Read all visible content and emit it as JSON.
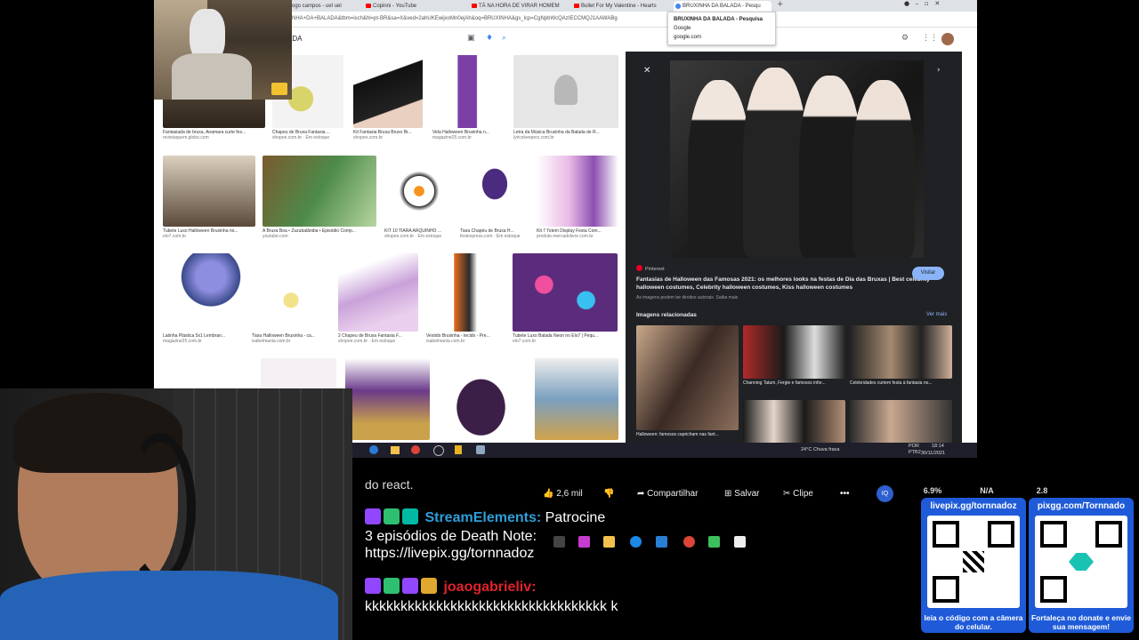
{
  "browser": {
    "tabs": [
      {
        "label": "ogo campos - uel uel"
      },
      {
        "label": "Copinni - YouTube"
      },
      {
        "label": "TÁ NA HORA DE VIRAR HOMEM"
      },
      {
        "label": "Bullet For My Valentine - Hearts"
      },
      {
        "label": "BRUXINHA DA BALADA - Pesqu"
      }
    ],
    "address": "NHA+DA+BALADA&tbm=isch&hl=pt-BR&sa=X&ved=2ahUKEwijxoMn0ejAh&oq=BRUXINHA&gs_lcp=CgNpbWcQAzIECCMQJ1AAWABg",
    "search_query": "ADA",
    "tooltip": {
      "title": "BRUXINHA DA BALADA - Pesquisa",
      "line2": "Google",
      "line3": "google.com"
    }
  },
  "results": [
    {
      "caption": "Fantasiada de bruxa, Anamara curte fes...",
      "source": "revistaquem.globo.com"
    },
    {
      "caption": "Chapeu de Bruxa Fantasia ...",
      "source": "shopee.com.br · Em estoque"
    },
    {
      "caption": "Kit Fantasia Bruxa Bruxo Br...",
      "source": "shopee.com.br"
    },
    {
      "caption": "Vela Halloween Bruxinha n...",
      "source": "magazine25.com.br"
    },
    {
      "caption": "Letra da Música Bruxinha da Balada de R...",
      "source": "lyricskeepers.com.br"
    },
    {
      "caption": "Tubete Luxo Halloween Bruxinha no...",
      "source": "elo7.com.br"
    },
    {
      "caption": "A Bruxa Boa • Zuzubalândia • Episódio Comp...",
      "source": "youtube.com"
    },
    {
      "caption": "KIT 10 TIARA ARQUINHO ...",
      "source": "shopee.com.br · Em estoque"
    },
    {
      "caption": "Tiara Chapéu de Bruxa H...",
      "source": "festexpress.com · Em estoque"
    },
    {
      "caption": "Kit 7 Totem Display Festa Com...",
      "source": "produto.mercadolivre.com.br"
    },
    {
      "caption": "Latinha Plástica 5x1 Lembran...",
      "source": "magazine25.com.br"
    },
    {
      "caption": "Tiara Halloween Bruxinha - ca...",
      "source": "isabelmania.com.br"
    },
    {
      "caption": "2 Chapeu de Bruxa Fantasia F...",
      "source": "shopee.com.br · Em estoque"
    },
    {
      "caption": "Vestido Bruxinha - tecido - Pre...",
      "source": "isabelmania.com.br"
    },
    {
      "caption": "Tubete Luxo Balada Neon no Elo7 | Pequ...",
      "source": "elo7.com.br"
    }
  ],
  "panel": {
    "source": "Pinterest",
    "title": "Fantasias de Halloween das Famosas 2021: os melhores looks na festas de Dia das Bruxas | Best celebrity halloween costumes, Celebrity halloween costumes, Kiss halloween costumes",
    "visit_label": "Visitar",
    "rights": "As imagens podem ter direitos autorais. Saiba mais",
    "related_label": "Imagens relacionadas",
    "more_label": "Ver mais",
    "related": [
      {
        "caption": "Halloween: famosos capricham nas fant..."
      },
      {
        "caption": "Channing Tatum, Fergie e famosos infor..."
      },
      {
        "caption": "Celebridades curtem festa à fantasia no..."
      }
    ]
  },
  "inner_taskbar": {
    "weather": "24°C  Chuva fraca",
    "lang": "POR PTB2",
    "time": "18:14",
    "date": "30/11/2021"
  },
  "youtube_bar": {
    "partial_text": "do react.",
    "likes": "2,6 mil",
    "share": "Compartilhar",
    "save": "Salvar",
    "clip": "Clipe",
    "stats": [
      {
        "value": "6.9%"
      },
      {
        "value": "N/A"
      },
      {
        "value": "2.8"
      }
    ]
  },
  "chat": [
    {
      "user": "StreamElements:",
      "user_color": "#2e9ed8",
      "message_inline": "Patrocine",
      "message": "3 episódios de Death Note: https://livepix.gg/tornnadoz"
    },
    {
      "user": "joaogabrieliv:",
      "user_color": "#e0232d",
      "message": "kkkkkkkkkkkkkkkkkkkkkkkkkkkkkkkkkk k"
    }
  ],
  "qr_codes": [
    {
      "label": "livepix.gg/tornnadoz",
      "footer": "leia o código com a câmera do celular."
    },
    {
      "label": "pixgg.com/Tornnado",
      "footer": "Fortaleça no donate e envie sua mensagem!"
    }
  ]
}
